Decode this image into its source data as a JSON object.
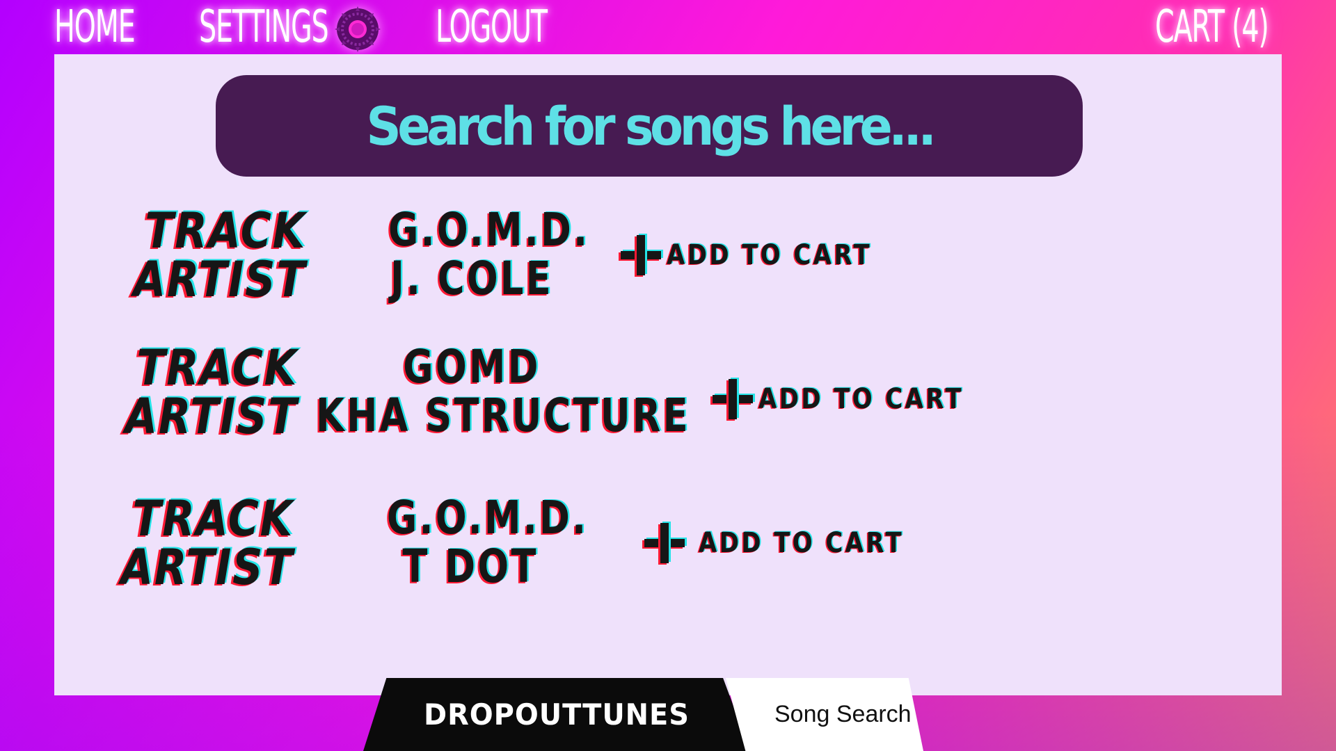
{
  "nav": {
    "home": "HOME",
    "settings": "SETTINGS",
    "settings_icon": "gear-icon",
    "logout": "LOGOUT",
    "cart": "CART (4)"
  },
  "search": {
    "placeholder": "Search for songs here..."
  },
  "labels": {
    "track": "TRACK",
    "artist": "ARTIST"
  },
  "results": [
    {
      "track": "G.O.M.D.",
      "artist": "J. COLE",
      "action": "ADD TO CART",
      "icon": "plus-icon"
    },
    {
      "track": "GOMD",
      "artist": "KHA STRUCTURE",
      "action": "ADD TO CART",
      "icon": "plus-icon"
    },
    {
      "track": "G.O.M.D.",
      "artist": "T DOT",
      "action": "ADD TO CART",
      "icon": "plus-icon"
    }
  ],
  "footer": {
    "brand": "DROPOUTTUNES",
    "page": "Song Search"
  },
  "colors": {
    "panel": "#efe1fb",
    "search_bg": "#471b52",
    "search_text": "#5ee0e6",
    "text": "#161616",
    "glitch_red": "#ff1a35",
    "glitch_cyan": "#25e4e8"
  }
}
